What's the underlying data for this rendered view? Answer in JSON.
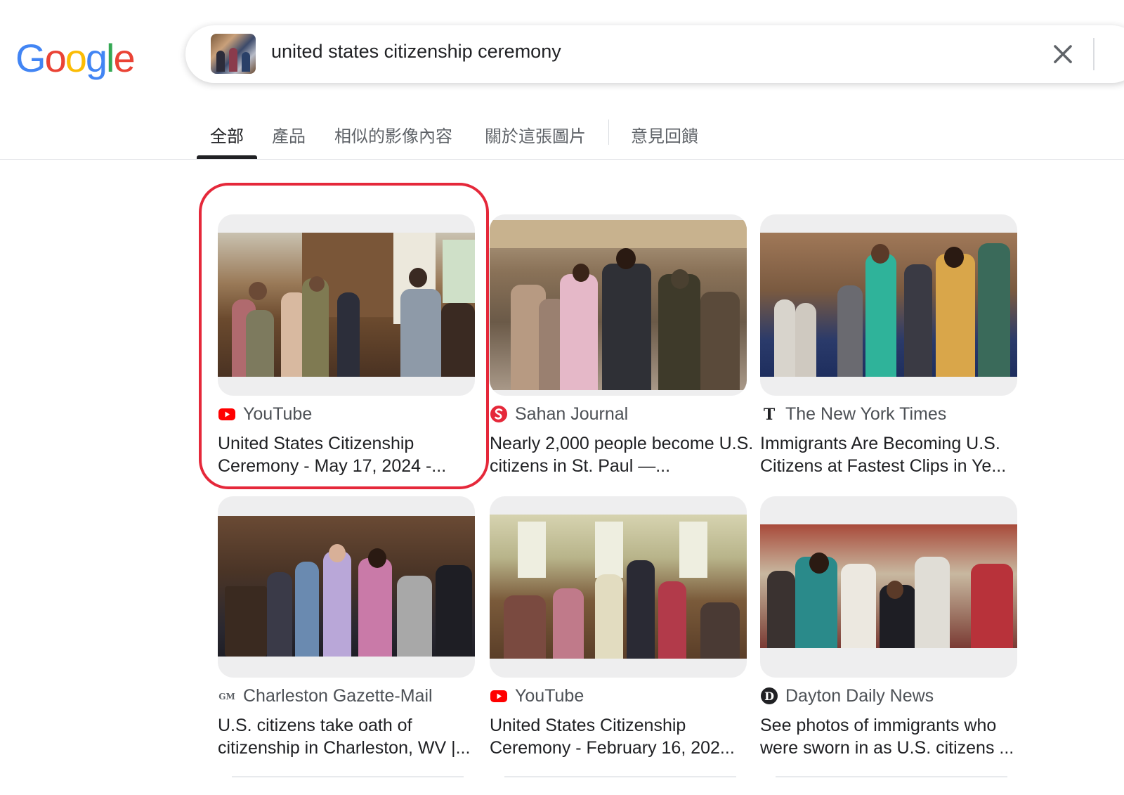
{
  "logo": {
    "letters": [
      "G",
      "o",
      "o",
      "g",
      "l",
      "e"
    ],
    "colors": [
      "#4285F4",
      "#EA4335",
      "#FBBC05",
      "#4285F4",
      "#34A853",
      "#EA4335"
    ]
  },
  "search": {
    "query": "united states citizenship ceremony",
    "clear_icon": "close-icon",
    "thumbnail": "search-image-thumbnail"
  },
  "tabs": [
    {
      "label": "全部",
      "active": true
    },
    {
      "label": "產品",
      "active": false
    },
    {
      "label": "相似的影像內容",
      "active": false
    },
    {
      "label": "關於這張圖片",
      "active": false
    },
    {
      "label": "意見回饋",
      "active": false
    }
  ],
  "results": [
    {
      "source": "YouTube",
      "source_icon": "youtube-icon",
      "title": "United States Citizenship Ceremony - May 17, 2024 -...",
      "highlighted": true
    },
    {
      "source": "Sahan Journal",
      "source_icon": "sahan-journal-icon",
      "title": "Nearly 2,000 people become U.S. citizens in St. Paul —...",
      "highlighted": false
    },
    {
      "source": "The New York Times",
      "source_icon": "nyt-icon",
      "title": "Immigrants Are Becoming U.S. Citizens at Fastest Clips in Ye...",
      "highlighted": false
    },
    {
      "source": "Charleston Gazette-Mail",
      "source_icon": "gazette-mail-icon",
      "title": "U.S. citizens take oath of citizenship in Charleston, WV |...",
      "highlighted": false
    },
    {
      "source": "YouTube",
      "source_icon": "youtube-icon",
      "title": "United States Citizenship Ceremony - February 16, 202...",
      "highlighted": false
    },
    {
      "source": "Dayton Daily News",
      "source_icon": "dayton-daily-news-icon",
      "title": "See photos of immigrants who were sworn in as U.S. citizens ...",
      "highlighted": false
    }
  ],
  "colors": {
    "highlight": "#e5283a",
    "youtube_red": "#ff0000",
    "sahan_red": "#e5283a",
    "tab_active": "#202124",
    "tab_inactive": "#5f6368"
  }
}
